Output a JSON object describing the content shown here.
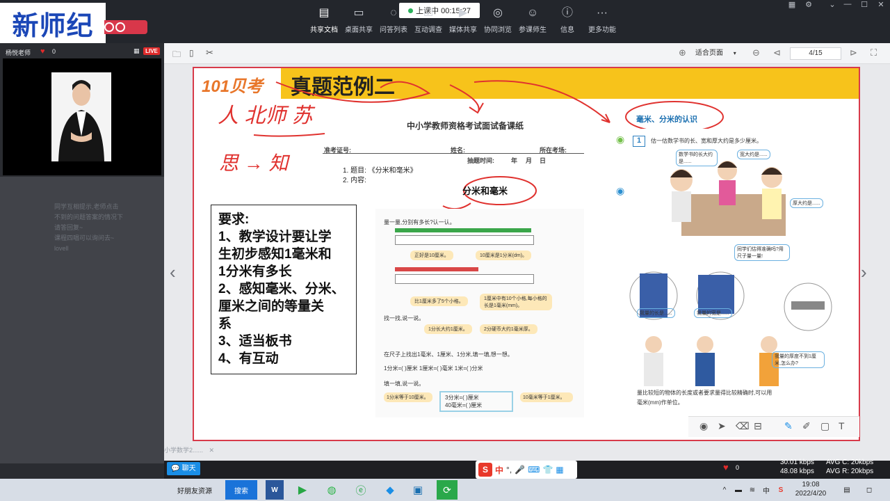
{
  "app": {
    "brand": "新师纪",
    "timer_label": "上课中 00:15:27"
  },
  "toolbar": {
    "items": [
      {
        "label": "共享文档",
        "icon": "document-icon"
      },
      {
        "label": "桌面共享",
        "icon": "monitor-icon"
      },
      {
        "label": "问答列表",
        "icon": "chat-icon"
      },
      {
        "label": "互动调查",
        "icon": "survey-icon"
      },
      {
        "label": "媒体共享",
        "icon": "media-icon"
      },
      {
        "label": "协同浏览",
        "icon": "compass-icon"
      },
      {
        "label": "参课师生",
        "icon": "users-icon"
      },
      {
        "label": "信息",
        "icon": "info-icon"
      },
      {
        "label": "更多功能",
        "icon": "more-icon"
      }
    ]
  },
  "teacher": {
    "name": "杨悦老师",
    "likes": "0",
    "live": "LIVE"
  },
  "chat_faint": [
    "同学互相提示,老师点击",
    "不到的问题答案的情况下",
    "请答回复~",
    "课程四唱可以询问去~",
    "lovell"
  ],
  "doc_toolbar": {
    "fit_label": "适合页面",
    "page": "4/15"
  },
  "slide": {
    "logo": "101贝考",
    "title": "真题范例二",
    "exam_title": "中小学教师资格考试面试备课纸",
    "fields": {
      "exam_no": "准考证号:",
      "name": "姓名:",
      "location": "所在考场:",
      "draw_time": "抽题时间:",
      "year": "年",
      "month": "月",
      "day": "日"
    },
    "topic_line": "1. 题目: 《分米和毫米》",
    "content_line": "2. 内容:",
    "handwriting": {
      "h1": "人 北师 苏",
      "h2": "思 → 知",
      "circle_top": "毫米、分米的认识",
      "circle_mid": "分米和毫米"
    },
    "requirements": [
      "要求:",
      "1、教学设计要让学",
      "生初步感知1毫米和",
      "1分米有多长",
      "2、感知毫米、分米、",
      "厘米之间的等量关",
      "系",
      "3、适当板书",
      "4、有互动"
    ],
    "textbook_left": {
      "line1": "量一量,分别有多长?认一认。",
      "bubble1": "正好是10厘米。",
      "bubble2": "10厘米是1分米(dm)。",
      "bubble3": "比1厘米多了5个小格。",
      "bubble4": "1厘米中有10个小格,每小格的长是1毫米(mm)。",
      "line2": "找一找,说一说。",
      "bubble5": "1分长大约1厘米。",
      "bubble6": "2分硬币大约1毫米厚。",
      "line3": "在尺子上找出1毫米、1厘米、1分米,填一填,想一想。",
      "line4": "1分米=( )厘米   1厘米=( )毫米   1米=( )分米",
      "line5": "填一填,说一说。",
      "box1": "1分米等于10厘米。",
      "box2": "3分米=( )厘米",
      "box3": "40毫米=( )厘米",
      "box4": "10毫米等于1厘米。"
    },
    "textbook_right": {
      "badge": "1",
      "line1": "估一估数学书的长、宽和厚大约是多少厘米。",
      "bubble1": "数学书的长大约是......",
      "bubble2": "宽大约是......",
      "bubble3": "厚大约是......",
      "bubble4": "同学们估得准确吗?用尺子量一量!",
      "bubble5": "我量的长是......",
      "bubble6": "我量的宽是......",
      "bubble7": "我量的厚度不到1厘米,怎么办?",
      "footer1": "量比较短的物体的长度或者要求量得比较精确时,可以用",
      "footer2": "毫米(mm)作单位。"
    }
  },
  "bottom": {
    "tab_label": "小学数学2......",
    "chat_button": "聊天",
    "likes": "0",
    "net_up": "30.01 kbps",
    "net_down": "48.08 kbps",
    "avg_up": "AVG C: 20kbps",
    "avg_down": "AVG R: 20kbps"
  },
  "taskbar": {
    "search_hint": "好朋友资源",
    "search_btn": "搜索",
    "time": "19:08",
    "date": "2022/4/20",
    "ime": "中"
  },
  "colors": {
    "brand_blue": "#1b47b7",
    "banner_yellow": "#f7c31b",
    "slide_border": "#d83a4a",
    "live_red": "#e02b2b",
    "chat_blue": "#1a8ee6"
  }
}
